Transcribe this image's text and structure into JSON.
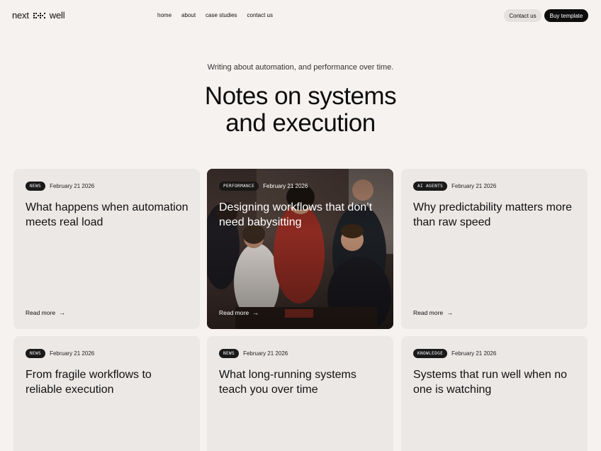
{
  "header": {
    "logo_left": "next",
    "logo_right": "well",
    "nav": [
      "home",
      "about",
      "case studies",
      "contact us"
    ],
    "contact_label": "Contact us",
    "buy_label": "Buy template"
  },
  "hero": {
    "subtitle": "Writing about automation, and performance over time.",
    "title_line1": "Notes on systems",
    "title_line2": "and execution"
  },
  "cards": [
    {
      "tag": "NEWS",
      "date": "February 21 2026",
      "title": "What happens when automation meets real load",
      "read_more": "Read more"
    },
    {
      "tag": "PERFORMANCE",
      "date": "February 21 2026",
      "title": "Designing workflows that don’t need babysitting",
      "read_more": "Read more"
    },
    {
      "tag": "AI AGENTS",
      "date": "February 21 2026",
      "title": "Why predictability matters more than raw speed",
      "read_more": "Read more"
    },
    {
      "tag": "NEWS",
      "date": "February 21 2026",
      "title": "From fragile workflows to reliable execution"
    },
    {
      "tag": "NEWS",
      "date": "February 21 2026",
      "title": "What long-running systems teach you over time"
    },
    {
      "tag": "KNOWLEDGE",
      "date": "February 21 2026",
      "title": "Systems that run well when no one is watching"
    }
  ],
  "icons": {
    "read_more": "arrow-right-icon",
    "logo": "dot-grid-icon"
  },
  "colors": {
    "background": "#f5f2f0",
    "card": "#ebe8e6",
    "dark": "#0d0d0d"
  }
}
